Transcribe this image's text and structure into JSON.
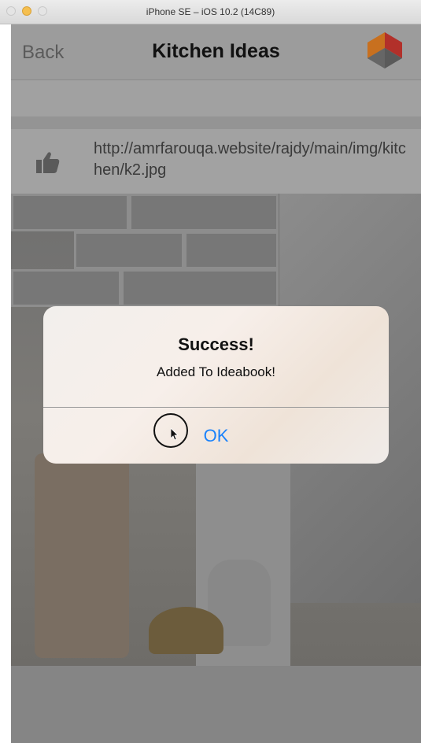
{
  "window": {
    "title": "iPhone SE – iOS 10.2 (14C89)"
  },
  "navbar": {
    "back_label": "Back",
    "title": "Kitchen Ideas",
    "logo_icon": "cube-logo-icon"
  },
  "item": {
    "like_icon": "thumbs-up-icon",
    "url": "http://amrfarouqa.website/rajdy/main/img/kitchen/k2.jpg"
  },
  "alert": {
    "title": "Success!",
    "message": "Added To Ideabook!",
    "ok_label": "OK"
  },
  "colors": {
    "link_blue": "#1a82fb",
    "logo_orange": "#e67a22",
    "logo_red": "#c8342a"
  }
}
